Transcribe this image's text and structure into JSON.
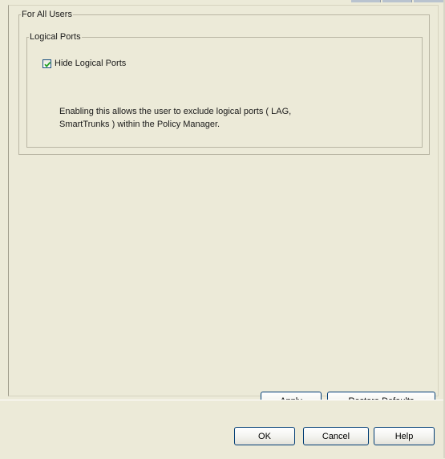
{
  "options_panel": {
    "group_for_all_users": "For All Users",
    "group_logical_ports": "Logical Ports",
    "hide_logical_ports": {
      "label": "Hide Logical Ports",
      "checked": true
    },
    "description": "Enabling this allows the user to exclude logical ports ( LAG,\nSmartTrunks ) within the Policy Manager."
  },
  "panel_buttons": {
    "apply": "Apply",
    "restore_defaults": "Restore Defaults"
  },
  "dialog_buttons": {
    "ok": "OK",
    "cancel": "Cancel",
    "help": "Help"
  },
  "colors": {
    "dialog_background": "#ecead8",
    "checkmark": "#21a121",
    "button_border": "#003c74"
  }
}
